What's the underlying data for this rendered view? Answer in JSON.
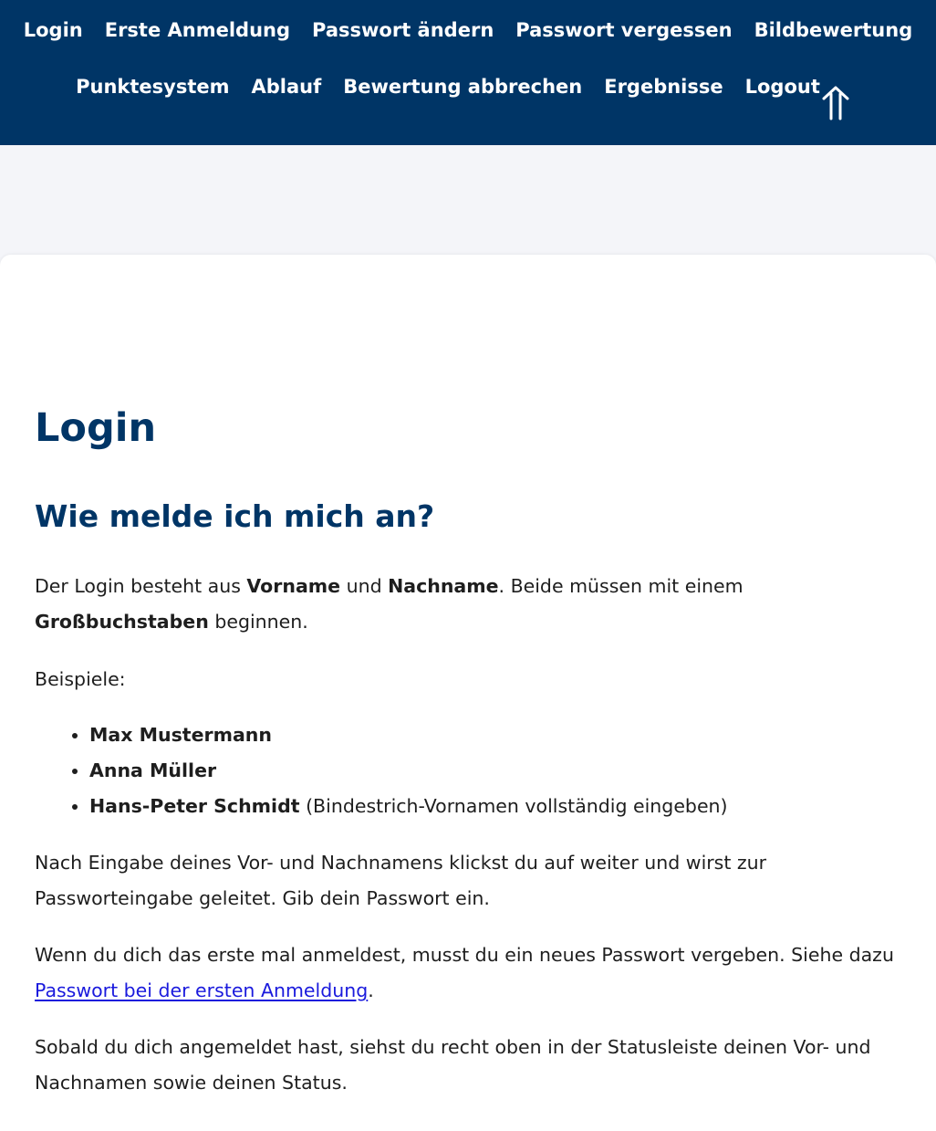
{
  "nav": {
    "row1": [
      {
        "id": "login",
        "label": "Login"
      },
      {
        "id": "erste-anmeldung",
        "label": "Erste Anmeldung"
      },
      {
        "id": "passwort-aendern",
        "label": "Passwort ändern"
      },
      {
        "id": "passwort-vergessen",
        "label": "Passwort vergessen"
      },
      {
        "id": "bildbewertung",
        "label": "Bildbewertung"
      }
    ],
    "row2": [
      {
        "id": "punktesystem",
        "label": "Punktesystem"
      },
      {
        "id": "ablauf",
        "label": "Ablauf"
      },
      {
        "id": "bewertung-abbrechen",
        "label": "Bewertung abbrechen"
      },
      {
        "id": "ergebnisse",
        "label": "Ergebnisse"
      },
      {
        "id": "logout",
        "label": "Logout"
      }
    ],
    "back_to_top_icon": "double-up-arrow-icon"
  },
  "colors": {
    "nav_background": "#003566",
    "heading": "#003566",
    "page_background": "#f4f5f9",
    "link": "#1a1add"
  },
  "main": {
    "title": "Login",
    "subtitle": "Wie melde ich mich an?",
    "p1": {
      "t1": "Der Login besteht aus ",
      "b1": "Vorname",
      "t2": " und ",
      "b2": "Nachname",
      "t3": ". Beide müssen mit einem ",
      "b3": "Großbuchstaben",
      "t4": " beginnen."
    },
    "p2": "Beispiele:",
    "examples": [
      {
        "name": "Max Mustermann",
        "note": ""
      },
      {
        "name": "Anna Müller",
        "note": ""
      },
      {
        "name": "Hans-Peter Schmidt",
        "note": " (Bindestrich-Vornamen vollständig eingeben)"
      }
    ],
    "p3": "Nach Eingabe deines Vor- und Nachnamens klickst du auf weiter und wirst zur Passworteingabe geleitet. Gib dein Passwort ein.",
    "p4": {
      "t1": "Wenn du dich das erste mal anmeldest, musst du ein neues Passwort vergeben. Siehe dazu ",
      "link": "Passwort bei der ersten Anmeldung",
      "t2": "."
    },
    "p5": "Sobald du dich angemeldet hast, siehst du recht oben in der Statusleiste deinen Vor- und Nachnamen sowie deinen Status."
  }
}
